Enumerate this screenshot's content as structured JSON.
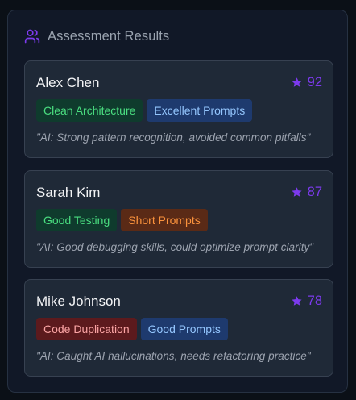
{
  "panel": {
    "title": "Assessment Results",
    "icon": "users-icon",
    "accent_color": "#7c3aed"
  },
  "candidates": [
    {
      "name": "Alex Chen",
      "score": "92",
      "tags": [
        {
          "label": "Clean Architecture",
          "variant": "green"
        },
        {
          "label": "Excellent Prompts",
          "variant": "blue"
        }
      ],
      "note": "\"AI: Strong pattern recognition, avoided common pitfalls\""
    },
    {
      "name": "Sarah Kim",
      "score": "87",
      "tags": [
        {
          "label": "Good Testing",
          "variant": "green"
        },
        {
          "label": "Short Prompts",
          "variant": "orange"
        }
      ],
      "note": "\"AI: Good debugging skills, could optimize prompt clarity\""
    },
    {
      "name": "Mike Johnson",
      "score": "78",
      "tags": [
        {
          "label": "Code Duplication",
          "variant": "red"
        },
        {
          "label": "Good Prompts",
          "variant": "blue"
        }
      ],
      "note": "\"AI: Caught AI hallucinations, needs refactoring practice\""
    }
  ]
}
